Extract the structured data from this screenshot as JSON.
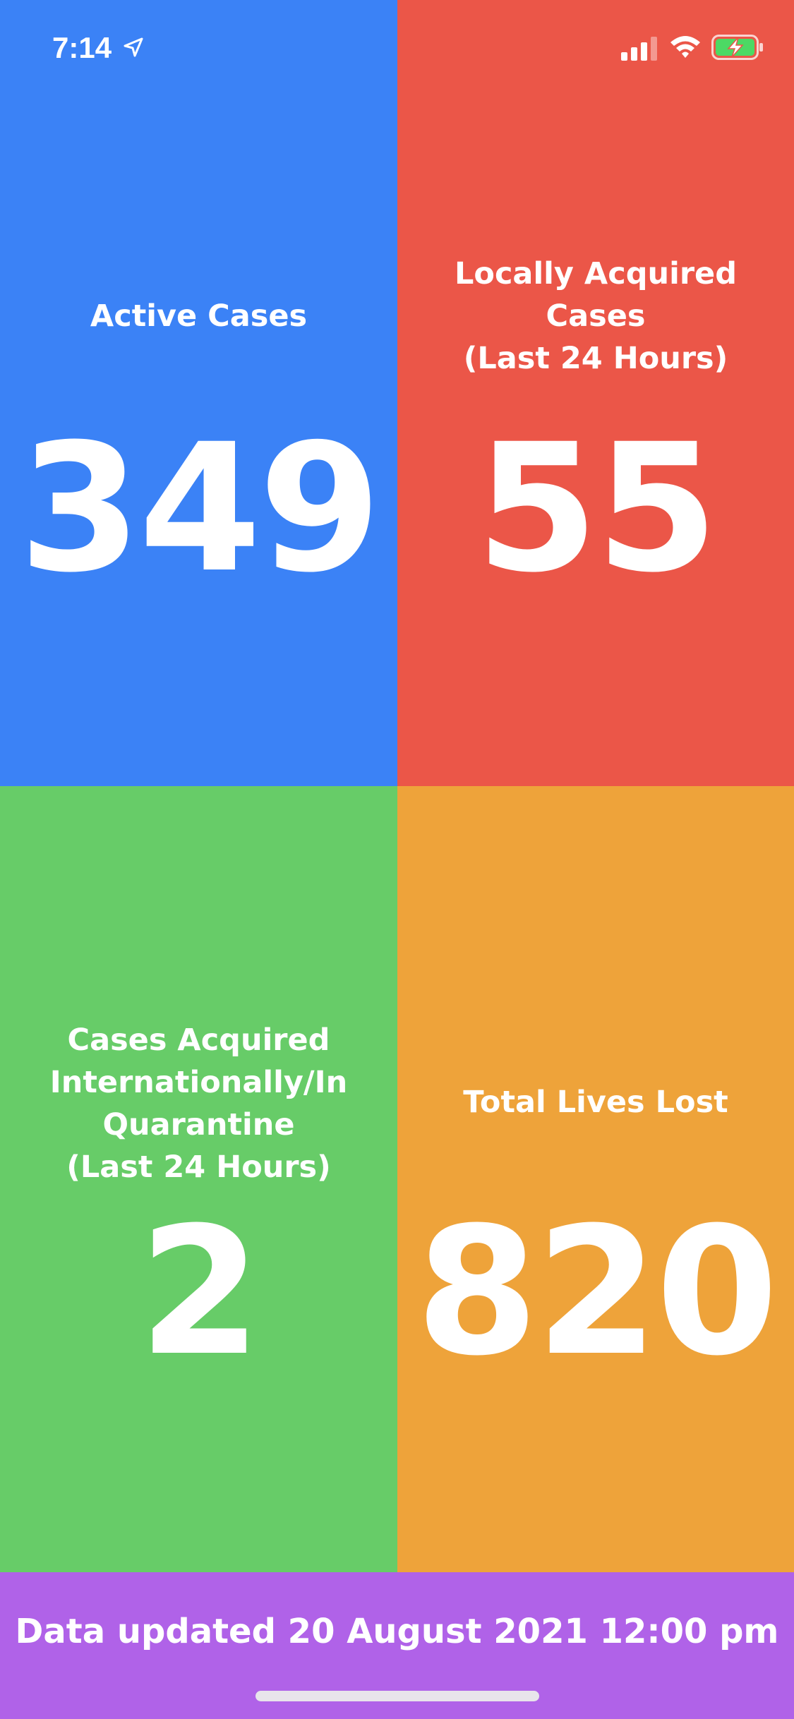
{
  "status_bar": {
    "time": "7:14",
    "icons": [
      "location-arrow-icon",
      "cellular-signal-icon",
      "wifi-icon",
      "battery-charging-icon"
    ]
  },
  "tiles": [
    {
      "label": "Active Cases",
      "value": "349",
      "color": "#3b82f6"
    },
    {
      "label": "Locally Acquired\nCases\n(Last 24 Hours)",
      "value": "55",
      "color": "#eb5648"
    },
    {
      "label": "Cases Acquired\nInternationally/In\nQuarantine\n(Last 24 Hours)",
      "value": "2",
      "color": "#67cc68"
    },
    {
      "label": "Total Lives Lost",
      "value": "820",
      "color": "#eea33a"
    }
  ],
  "footer": {
    "text": "Data updated 20 August 2021 12:00 pm",
    "color": "#b062e8"
  }
}
